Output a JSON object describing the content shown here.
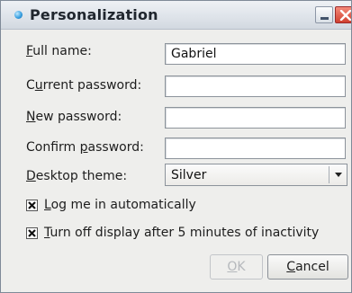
{
  "window": {
    "title": "Personalization",
    "icons": {
      "app": "app-icon",
      "minimize": "minimize-icon",
      "close": "close-icon"
    }
  },
  "form": {
    "full_name": {
      "label_mn": "F",
      "label_rest": "ull name:",
      "value": "Gabriel"
    },
    "current_password": {
      "label_pre": "C",
      "label_mn": "u",
      "label_rest": "rrent password:",
      "value": ""
    },
    "new_password": {
      "label_mn": "N",
      "label_rest": "ew password:",
      "value": ""
    },
    "confirm_password": {
      "label_pre": "Confirm ",
      "label_mn": "p",
      "label_rest": "assword:",
      "value": ""
    },
    "desktop_theme": {
      "label_mn": "D",
      "label_rest": "esktop theme:",
      "value": "Silver",
      "icon": "chevron-down-icon"
    }
  },
  "options": {
    "auto_login": {
      "label_mn": "L",
      "label_rest": "og me in automatically",
      "checked": true
    },
    "display_off": {
      "label_mn": "T",
      "label_rest": "urn off display after 5 minutes of inactivity",
      "checked": true
    }
  },
  "buttons": {
    "ok": {
      "label_mn": "O",
      "label_rest": "K",
      "enabled": false
    },
    "cancel": {
      "label_mn": "C",
      "label_rest": "ancel",
      "enabled": true
    }
  },
  "colors": {
    "ok_disabled_text": "#b5b8bc",
    "close_button": "#d0402f"
  }
}
